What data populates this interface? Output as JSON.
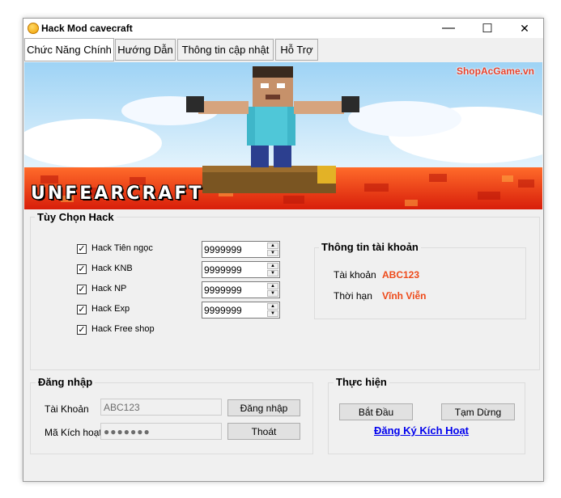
{
  "window": {
    "title": "Hack Mod cavecraft",
    "minimize_glyph": "—",
    "maximize_glyph": "☐",
    "close_glyph": "✕"
  },
  "tabs": [
    {
      "label": "Chức Năng Chính",
      "active": true
    },
    {
      "label": "Hướng Dẫn",
      "active": false
    },
    {
      "label": "Thông tin cập nhật",
      "active": false
    },
    {
      "label": "Hỗ Trợ",
      "active": false
    }
  ],
  "banner": {
    "watermark": "ShopAcGame.vn",
    "logo_text": "UNFEARCRAFT"
  },
  "hack_options": {
    "title": "Tùy Chọn Hack",
    "items": [
      {
        "label": "Hack Tiên ngọc",
        "checked": true,
        "value": "9999999"
      },
      {
        "label": "Hack KNB",
        "checked": true,
        "value": "9999999"
      },
      {
        "label": "Hack NP",
        "checked": true,
        "value": "9999999"
      },
      {
        "label": "Hack Exp",
        "checked": true,
        "value": "9999999"
      },
      {
        "label": "Hack Free shop",
        "checked": true
      }
    ]
  },
  "account_info": {
    "title": "Thông tin tài khoản",
    "account_label": "Tài khoản",
    "account_value": "ABC123",
    "duration_label": "Thời hạn",
    "duration_value": "Vĩnh Viễn"
  },
  "login": {
    "title": "Đăng nhập",
    "account_label": "Tài Khoản",
    "account_value": "ABC123",
    "code_label": "Mã Kích hoạt",
    "code_value": "●●●●●●●",
    "login_button": "Đăng nhập",
    "exit_button": "Thoát"
  },
  "actions": {
    "title": "Thực hiện",
    "start_button": "Bắt Đầu",
    "pause_button": "Tạm Dừng",
    "register_link": "Đăng Ký Kích Hoạt"
  },
  "colors": {
    "accent_orange": "#ee4a1a",
    "link_blue": "#0000ee",
    "window_bg": "#f0f0f0"
  }
}
